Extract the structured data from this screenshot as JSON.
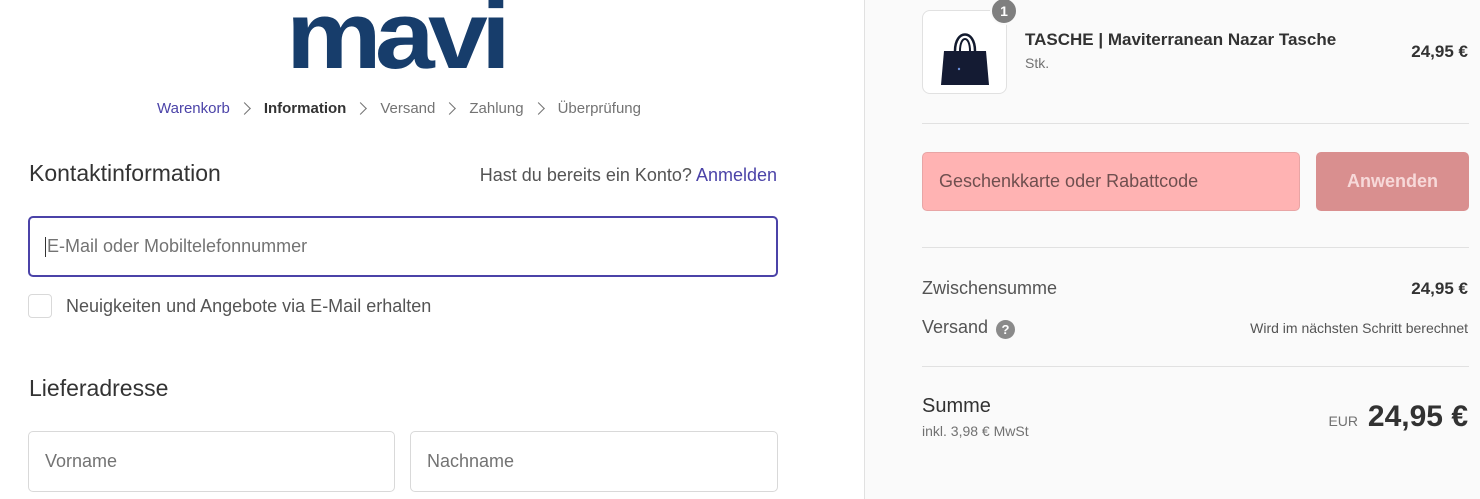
{
  "brand": {
    "logo_text": "mavi",
    "color": "#173d6b"
  },
  "breadcrumb": {
    "items": [
      "Warenkorb",
      "Information",
      "Versand",
      "Zahlung",
      "Überprüfung"
    ]
  },
  "contact": {
    "title": "Kontaktinformation",
    "login_prompt": "Hast du bereits ein Konto?",
    "login_link": "Anmelden",
    "email_placeholder": "E-Mail oder Mobiltelefonnummer",
    "newsletter_label": "Neuigkeiten und Angebote via E-Mail erhalten"
  },
  "shipping": {
    "title": "Lieferadresse",
    "first_name_placeholder": "Vorname",
    "last_name_placeholder": "Nachname"
  },
  "cart": {
    "item": {
      "quantity": "1",
      "name": "TASCHE | Maviterranean Nazar Tasche",
      "variant": "Stk.",
      "price": "24,95 €",
      "image_icon": "tote-bag-icon"
    },
    "discount_placeholder": "Geschenkkarte oder Rabattcode",
    "apply_label": "Anwenden",
    "subtotal_label": "Zwischensumme",
    "subtotal_value": "24,95 €",
    "shipping_label": "Versand",
    "shipping_value": "Wird im nächsten Schritt berechnet",
    "total_label": "Summe",
    "tax_note": "inkl. 3,98 € MwSt",
    "currency": "EUR",
    "total_value": "24,95 €"
  },
  "colors": {
    "accent": "#4b43a8",
    "discount_bg": "#ffb3b3",
    "apply_bg": "#d98f8f"
  }
}
